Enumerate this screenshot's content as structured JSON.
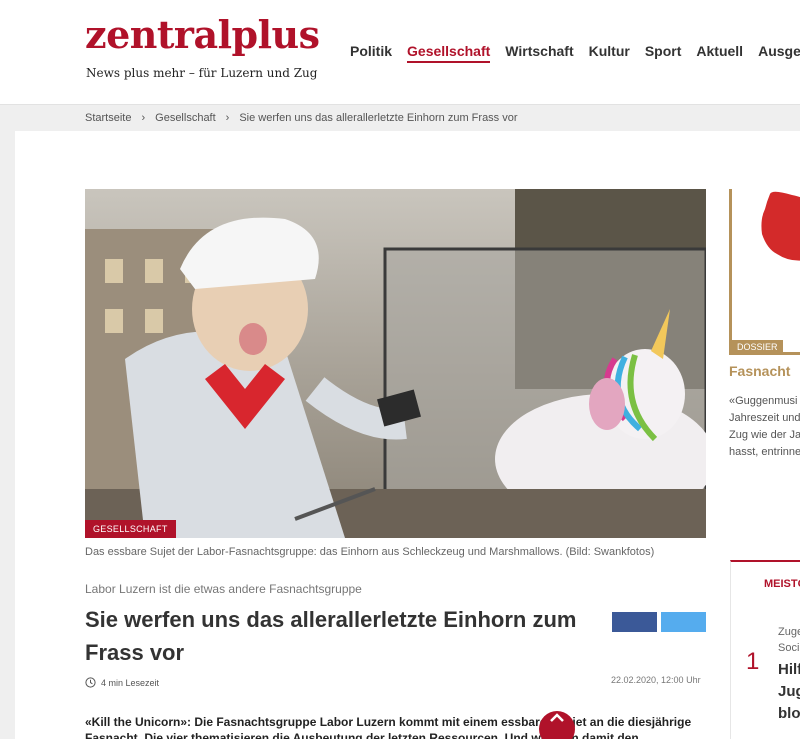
{
  "header": {
    "logo": "zentralplus",
    "tagline": "News plus mehr – für Luzern und Zug",
    "nav": [
      {
        "label": "Politik",
        "active": false
      },
      {
        "label": "Gesellschaft",
        "active": true
      },
      {
        "label": "Wirtschaft",
        "active": false
      },
      {
        "label": "Kultur",
        "active": false
      },
      {
        "label": "Sport",
        "active": false
      },
      {
        "label": "Aktuell",
        "active": false
      },
      {
        "label": "Ausgehe",
        "active": false
      }
    ]
  },
  "breadcrumb": {
    "home": "Startseite",
    "category": "Gesellschaft",
    "current": "Sie werfen uns das allerallerletzte Einhorn zum Frass vor",
    "separator": "›"
  },
  "article": {
    "category_badge": "GESELLSCHAFT",
    "caption": "Das essbare Sujet der Labor-Fasnachtsgruppe: das Einhorn aus Schleckzeug und Marshmallows. (Bild: Swankfotos)",
    "kicker": "Labor Luzern ist die etwas andere Fasnachtsgruppe",
    "title": "Sie werfen uns das allerallerletzte Einhorn zum Frass vor",
    "date": "22.02.2020, 12:00 Uhr",
    "read_time": "4 min Lesezeit",
    "lead_line1": "«Kill the Unicorn»: Die Fasnachtsgruppe Labor Luzern kommt mit einem essbaren Sujet an die diesjährige",
    "lead_line2": "Fasnacht. Die vier thematisieren die Ausbeutung der letzten Ressourcen. Und wie man damit den"
  },
  "sidebar": {
    "dossier_badge": "DOSSIER",
    "dossier_title": "Fasnacht",
    "dossier_lines": [
      "«Guggenmusi",
      "Jahreszeit und",
      "Zug wie der Ja",
      "hasst, entrinne"
    ],
    "popular_title": "MEISTG",
    "popular_num": "1",
    "popular_cat_lines": [
      "Zuge",
      "Soci"
    ],
    "popular_head_lines": [
      "Hilf",
      "Jug",
      "blos"
    ]
  },
  "colors": {
    "brand": "#b0122a",
    "dossier": "#b5925a",
    "facebook": "#3b5998",
    "twitter": "#55acee"
  },
  "icons": {
    "clock": "clock-icon",
    "scroll_top": "chevron-up-icon",
    "facebook": "facebook-icon",
    "twitter": "twitter-icon"
  }
}
